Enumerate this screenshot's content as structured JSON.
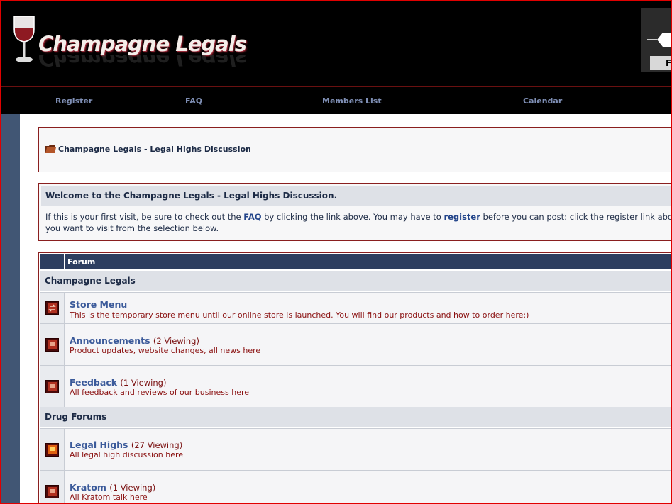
{
  "site": {
    "name": "Champagne Legals"
  },
  "nav": {
    "register": "Register",
    "faq": "FAQ",
    "members": "Members List",
    "calendar": "Calendar"
  },
  "banner": {
    "letter": "F"
  },
  "breadcrumb": {
    "text": "Champagne Legals - Legal Highs Discussion"
  },
  "welcome": {
    "title": "Welcome to the Champagne Legals - Legal Highs Discussion.",
    "line1_a": "If this is your first visit, be sure to check out the ",
    "faq_link": "FAQ",
    "line1_b": " by clicking the link above. You may have to ",
    "register_link": "register",
    "line1_c": " before you can post: click the register link above",
    "line2": "you want to visit from the selection below."
  },
  "forum_table": {
    "header": "Forum",
    "categories": [
      {
        "name": "Champagne Legals",
        "forums": [
          {
            "title": "Store Menu",
            "viewing": "",
            "desc": "This is the temporary store menu until our online store is launched. You will find our products and how to order here:)"
          },
          {
            "title": "Announcements",
            "viewing": "(2 Viewing)",
            "desc": "Product updates, website changes, all news here"
          },
          {
            "title": "Feedback",
            "viewing": "(1 Viewing)",
            "desc": "All feedback and reviews of our business here"
          }
        ]
      },
      {
        "name": "Drug Forums",
        "forums": [
          {
            "title": "Legal Highs",
            "viewing": "(27 Viewing)",
            "desc": "All legal high discussion here"
          },
          {
            "title": "Kratom",
            "viewing": "(1 Viewing)",
            "desc": "All Kratom talk here"
          }
        ]
      }
    ]
  },
  "colors": {
    "frame": "#e00000",
    "nav_link": "#7f8fb5",
    "sidebar": "#415674",
    "table_head": "#2d3e60",
    "category_bg": "#dee1e7",
    "forum_title": "#3b5a9a",
    "forum_desc": "#8a1010"
  }
}
